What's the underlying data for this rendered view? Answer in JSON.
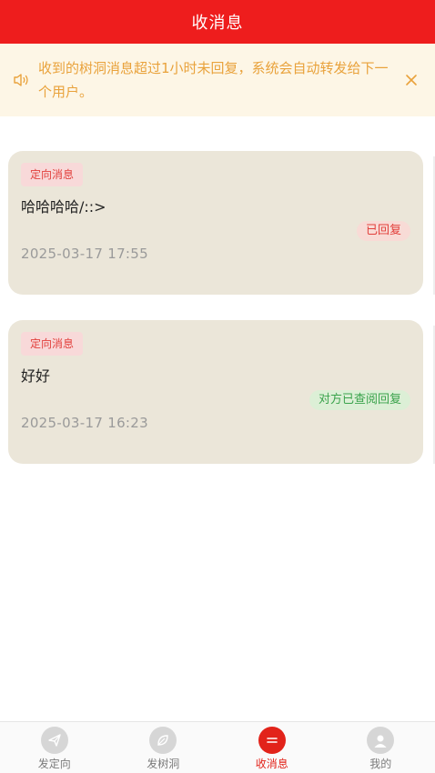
{
  "header": {
    "title": "收消息"
  },
  "notice": {
    "text": "收到的树洞消息超过1小时未回复，系统会自动转发给下一个用户。",
    "icon": "speaker-icon",
    "close_icon": "close-icon"
  },
  "messages": [
    {
      "tag": "定向消息",
      "content": "哈哈哈哈/::>",
      "status": "已回复",
      "time": "2025-03-17 17:55"
    },
    {
      "tag": "定向消息",
      "content": "好好",
      "status": "对方已查阅回复",
      "time": "2025-03-17 16:23"
    }
  ],
  "tabbar": {
    "items": [
      {
        "label": "发定向",
        "icon": "paper-plane-icon",
        "active": false
      },
      {
        "label": "发树洞",
        "icon": "leaf-icon",
        "active": false
      },
      {
        "label": "收消息",
        "icon": "message-icon",
        "active": true
      },
      {
        "label": "我的",
        "icon": "user-icon",
        "active": false
      }
    ]
  },
  "colors": {
    "brand": "#ee1d1d",
    "card_bg": "#ebe6d9",
    "notice_text": "#e9a23b",
    "replied": "#e2403c",
    "viewed": "#3aa34c"
  }
}
